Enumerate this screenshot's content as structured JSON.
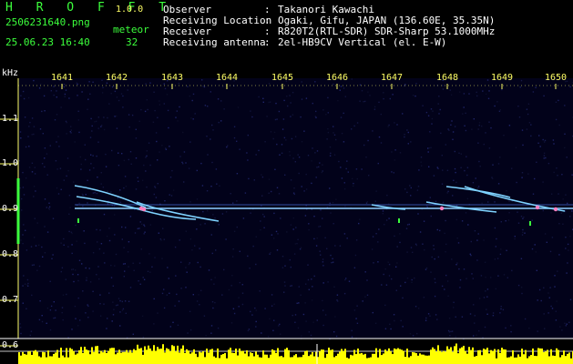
{
  "app": {
    "title": "H R O F F T",
    "version": "1.0.0",
    "file_name": "2506231640.png",
    "timestamp": "25.06.23 16:40",
    "meteor_label": "meteor",
    "meteor_count": "32"
  },
  "info": [
    {
      "key": "Observer",
      "value": "Takanori Kawachi"
    },
    {
      "key": "Receiving Location",
      "value": "Ogaki, Gifu, JAPAN (136.60E, 35.35N)"
    },
    {
      "key": "Receiver",
      "value": "R820T2(RTL-SDR) SDR-Sharp 53.1000MHz"
    },
    {
      "key": "Receiving antenna",
      "value": "2el-HB9CV Vertical (el. E-W)"
    }
  ],
  "spectrogram": {
    "unit_label": "kHz",
    "time_ticks": [
      "1641",
      "1642",
      "1643",
      "1644",
      "1645",
      "1646",
      "1647",
      "1648",
      "1649",
      "1650"
    ],
    "freq_ticks": [
      "1.1",
      "1.0",
      "0.9",
      "0.8",
      "0.7",
      "0.6"
    ],
    "colors": {
      "axis": "#ffff66",
      "text": "#ffffff",
      "trace": "#3cff3c",
      "signal": "#8fd0ff",
      "histogram": "#ffff00",
      "background": "#02021a"
    }
  }
}
